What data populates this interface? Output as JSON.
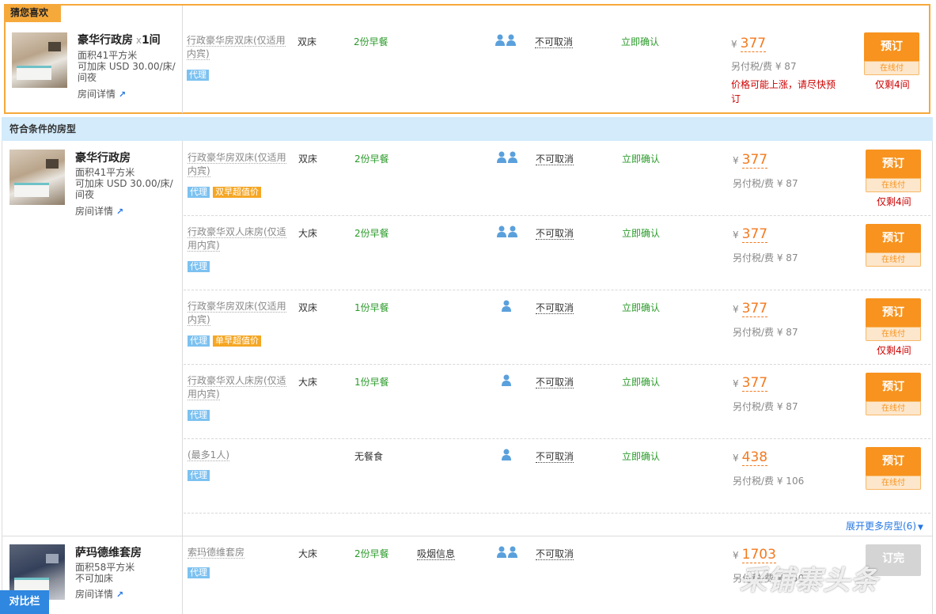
{
  "favorite": {
    "label": "猜您喜欢",
    "room_name": "豪华行政房",
    "multiplier": "x",
    "count": "1间",
    "area": "面积41平方米",
    "extra_bed": "可加床 USD 30.00/床/间夜",
    "details_link": "房间详情",
    "rate": {
      "name": "行政豪华房双床(仅适用内宾)",
      "bed": "双床",
      "breakfast": "2份早餐",
      "guests": 2,
      "cancel": "不可取消",
      "confirm": "立即确认",
      "currency": "¥",
      "price": "377",
      "tax": "另付税/费 ¥ 87",
      "tags": [
        "代理"
      ],
      "warning": "价格可能上涨，请尽快预订",
      "remain": "仅剩4间",
      "book_label": "预订",
      "pay_label": "在线付"
    }
  },
  "section_title": "符合条件的房型",
  "rooms": [
    {
      "name": "豪华行政房",
      "area": "面积41平方米",
      "extra_bed": "可加床 USD 30.00/床/间夜",
      "details_link": "房间详情",
      "rates": [
        {
          "name": "行政豪华房双床(仅适用内宾)",
          "bed": "双床",
          "breakfast": "2份早餐",
          "guests": 2,
          "cancel": "不可取消",
          "confirm": "立即确认",
          "currency": "¥",
          "price": "377",
          "tax": "另付税/费 ¥ 87",
          "tags": [
            "代理",
            "双早超值价"
          ],
          "remain": "仅剩4间",
          "book_label": "预订",
          "pay_label": "在线付"
        },
        {
          "name": "行政豪华双人床房(仅适用内宾)",
          "bed": "大床",
          "breakfast": "2份早餐",
          "guests": 2,
          "cancel": "不可取消",
          "confirm": "立即确认",
          "currency": "¥",
          "price": "377",
          "tax": "另付税/费 ¥ 87",
          "tags": [
            "代理"
          ],
          "remain": "",
          "book_label": "预订",
          "pay_label": "在线付"
        },
        {
          "name": "行政豪华房双床(仅适用内宾)",
          "bed": "双床",
          "breakfast": "1份早餐",
          "guests": 1,
          "cancel": "不可取消",
          "confirm": "立即确认",
          "currency": "¥",
          "price": "377",
          "tax": "另付税/费 ¥ 87",
          "tags": [
            "代理",
            "单早超值价"
          ],
          "remain": "仅剩4间",
          "book_label": "预订",
          "pay_label": "在线付"
        },
        {
          "name": "行政豪华双人床房(仅适用内宾)",
          "bed": "大床",
          "breakfast": "1份早餐",
          "guests": 1,
          "cancel": "不可取消",
          "confirm": "立即确认",
          "currency": "¥",
          "price": "377",
          "tax": "另付税/费 ¥ 87",
          "tags": [
            "代理"
          ],
          "remain": "",
          "book_label": "预订",
          "pay_label": "在线付"
        },
        {
          "name": "(最多1人)",
          "bed": "",
          "breakfast": "无餐食",
          "guests": 1,
          "cancel": "不可取消",
          "confirm": "立即确认",
          "currency": "¥",
          "price": "438",
          "tax": "另付税/费 ¥ 106",
          "tags": [
            "代理"
          ],
          "remain": "",
          "book_label": "预订",
          "pay_label": "在线付"
        }
      ],
      "expand_label": "展开更多房型(6)"
    },
    {
      "name": "萨玛德维套房",
      "area": "面积58平方米",
      "extra_bed": "不可加床",
      "details_link": "房间详情",
      "rate": {
        "name": "索玛德维套房",
        "bed": "大床",
        "breakfast": "2份早餐",
        "smoking": "吸烟信息",
        "guests": 2,
        "cancel": "不可取消",
        "currency": "¥",
        "price": "1703",
        "tax": "另付税/费 ¥ 350",
        "tags": [
          "代理"
        ],
        "book_label": "订完"
      }
    }
  ],
  "compare_tab": "对比栏",
  "watermark": "采铺寨头条"
}
